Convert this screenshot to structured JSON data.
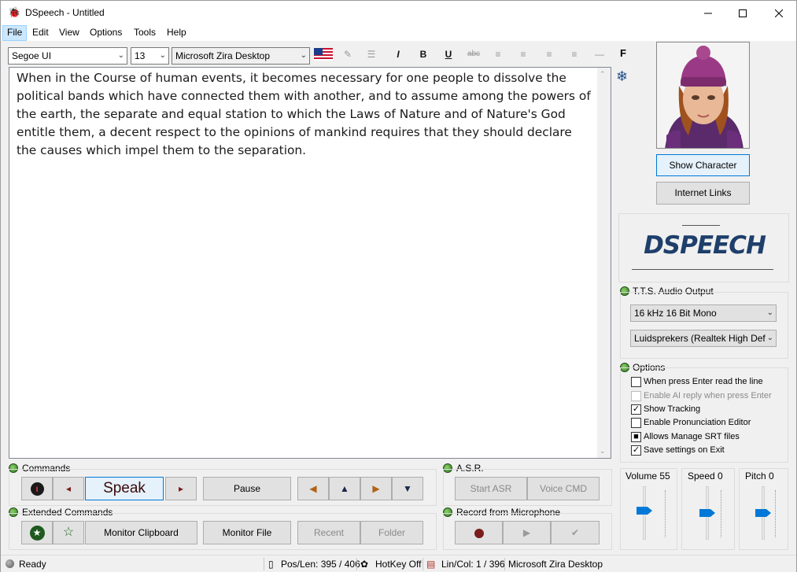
{
  "window": {
    "title": "DSpeech - Untitled"
  },
  "menu": [
    "File",
    "Edit",
    "View",
    "Options",
    "Tools",
    "Help"
  ],
  "toolbar": {
    "font": "Segoe UI",
    "font_size": "13",
    "voice": "Microsoft Zira Desktop",
    "italic": "I",
    "bold": "B",
    "underline": "U",
    "strike": "abc",
    "f_label": "F"
  },
  "document": {
    "text": "When in the Course of human events, it becomes necessary for one people to dissolve the political bands which have connected them with another, and to assume among the powers of the earth, the separate and equal station to which the Laws of Nature and of Nature's God entitle them, a decent respect to the opinions of mankind requires that they should declare the causes which impel them to the separation."
  },
  "side": {
    "show_character": "Show Character",
    "internet_links": "Internet Links",
    "logo_text": "DSPEECH"
  },
  "tts": {
    "label": "T.T.S. Audio Output",
    "format": "16 kHz 16 Bit Mono",
    "device": "Luidsprekers (Realtek High Def"
  },
  "options": {
    "label": "Options",
    "items": [
      {
        "label": "When press Enter read the line",
        "checked": "",
        "enabled": true
      },
      {
        "label": "Enable AI reply when press Enter",
        "checked": "",
        "enabled": false
      },
      {
        "label": "Show Tracking",
        "checked": "✓",
        "enabled": true
      },
      {
        "label": "Enable Pronunciation Editor",
        "checked": "",
        "enabled": true
      },
      {
        "label": "Allows Manage SRT files",
        "checked": "■",
        "enabled": true
      },
      {
        "label": "Save settings on Exit",
        "checked": "✓",
        "enabled": true
      }
    ]
  },
  "sliders": {
    "volume": {
      "label": "Volume 55",
      "value": 55
    },
    "speed": {
      "label": "Speed 0",
      "value": 0
    },
    "pitch": {
      "label": "Pitch 0",
      "value": 0
    }
  },
  "commands": {
    "label": "Commands",
    "speak": "Speak",
    "pause": "Pause"
  },
  "extended": {
    "label": "Extended Commands",
    "monitor_clipboard": "Monitor Clipboard",
    "monitor_file": "Monitor File",
    "recent": "Recent",
    "folder": "Folder"
  },
  "asr": {
    "label": "A.S.R.",
    "start": "Start ASR",
    "voice_cmd": "Voice CMD"
  },
  "record": {
    "label": "Record from Microphone"
  },
  "status": {
    "ready": "Ready",
    "pos_len": "Pos/Len: 395 / 406",
    "hotkey": "HotKey Off",
    "lin_col": "Lin/Col: 1 / 396",
    "voice": "Microsoft Zira Desktop"
  },
  "colors": {
    "accent": "#0078d7",
    "logo": "#1f3f6b",
    "record": "#7a1d1d"
  }
}
